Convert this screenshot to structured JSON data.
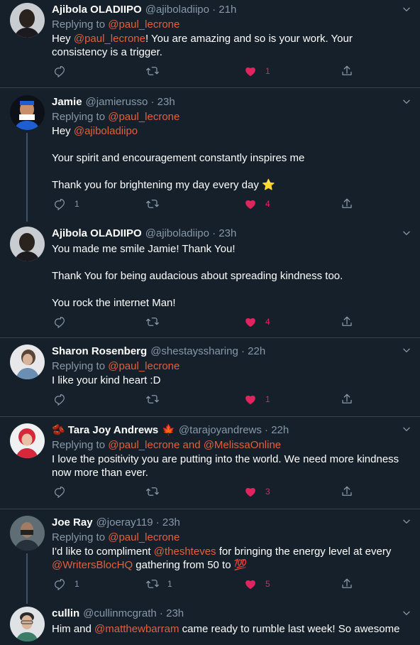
{
  "tweets": [
    {
      "name": "Ajibola OLADIIPO",
      "handle": "@ajiboladiipo · 21h",
      "replying_prefix": "Replying to ",
      "replying_to": "@paul_lecrone",
      "body_a": "Hey ",
      "mention1": "@paul_lecrone",
      "body_b": "! You are amazing and so is your work. Your consistency is a trigger.",
      "likes": "1"
    },
    {
      "name": "Jamie",
      "handle": "@jamierusso · 23h",
      "replying_prefix": "Replying to ",
      "replying_to": "@paul_lecrone",
      "line1_a": "Hey ",
      "line1_mention": "@ajiboladiipo",
      "line2": "Your spirit and encouragement constantly inspires me",
      "line3": "Thank you for brightening my day every day ⭐",
      "replies": "1",
      "likes": "4"
    },
    {
      "name": "Ajibola OLADIIPO",
      "handle": "@ajiboladiipo · 23h",
      "line1": "You made me smile Jamie! Thank You!",
      "line2": "Thank You for being audacious about spreading kindness too.",
      "line3": "You rock the internet Man!",
      "likes": "4"
    },
    {
      "name": "Sharon Rosenberg",
      "handle": "@shestayssharing · 22h",
      "replying_prefix": "Replying to ",
      "replying_to": "@paul_lecrone",
      "body": "I like your kind heart :D",
      "likes": "1"
    },
    {
      "name_prefix": "🫘",
      "name": "Tara Joy Andrews",
      "name_suffix": "🍁",
      "handle": "@tarajoyandrews · 22h",
      "replying_prefix": "Replying to ",
      "replying_to": "@paul_lecrone and @MelissaOnline",
      "body": "I love the positivity you are putting into the world. We need more kindness now more than ever.",
      "likes": "3"
    },
    {
      "name": "Joe Ray",
      "handle": "@joeray119 · 23h",
      "replying_prefix": "Replying to ",
      "replying_to": "@paul_lecrone",
      "body_a": "I'd like to compliment ",
      "mention1": "@theshteves",
      "body_b": " for bringing the energy level at every ",
      "mention2": "@WritersBlocHQ",
      "body_c": " gathering from 50 to 💯",
      "replies": "1",
      "retweets": "1",
      "likes": "5"
    },
    {
      "name": "cullin",
      "handle": "@cullinmcgrath · 23h",
      "body_a": "Him and ",
      "mention1": "@matthewbarram",
      "body_b": " came ready to rumble last week! So awesome"
    }
  ],
  "colors": {
    "background": "#15202b",
    "link": "#e0603f",
    "secondary": "#8899a6",
    "like": "#e0245e",
    "divider": "#38444d"
  },
  "icons": [
    "reply-icon",
    "retweet-icon",
    "like-icon",
    "share-icon",
    "chevron-down-icon"
  ]
}
